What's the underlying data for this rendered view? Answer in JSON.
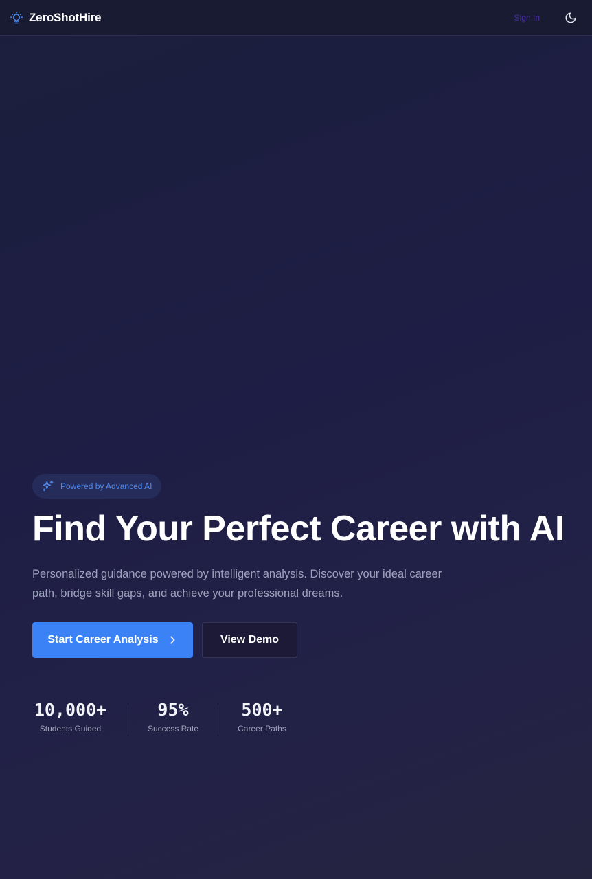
{
  "header": {
    "brand_name": "ZeroShotHire",
    "brand_icon": "lightbulb-icon",
    "sign_in_label": "Sign In",
    "theme_icon": "moon-icon"
  },
  "hero": {
    "badge_text": "Powered by Advanced AI",
    "badge_icon": "sparkles-icon",
    "title": "Find Your Perfect Career with AI",
    "subtitle": "Personalized guidance powered by intelligent analysis. Discover your ideal career path, bridge skill gaps, and achieve your professional dreams.",
    "primary_cta": "Start Career Analysis",
    "secondary_cta": "View Demo"
  },
  "stats": [
    {
      "value": "10,000+",
      "label": "Students Guided"
    },
    {
      "value": "95%",
      "label": "Success Rate"
    },
    {
      "value": "500+",
      "label": "Career Paths"
    }
  ],
  "colors": {
    "accent": "#3b82f6",
    "badge_text": "#4d8af0",
    "sign_in": "#4a2fa0",
    "background": "#1e1d45"
  }
}
